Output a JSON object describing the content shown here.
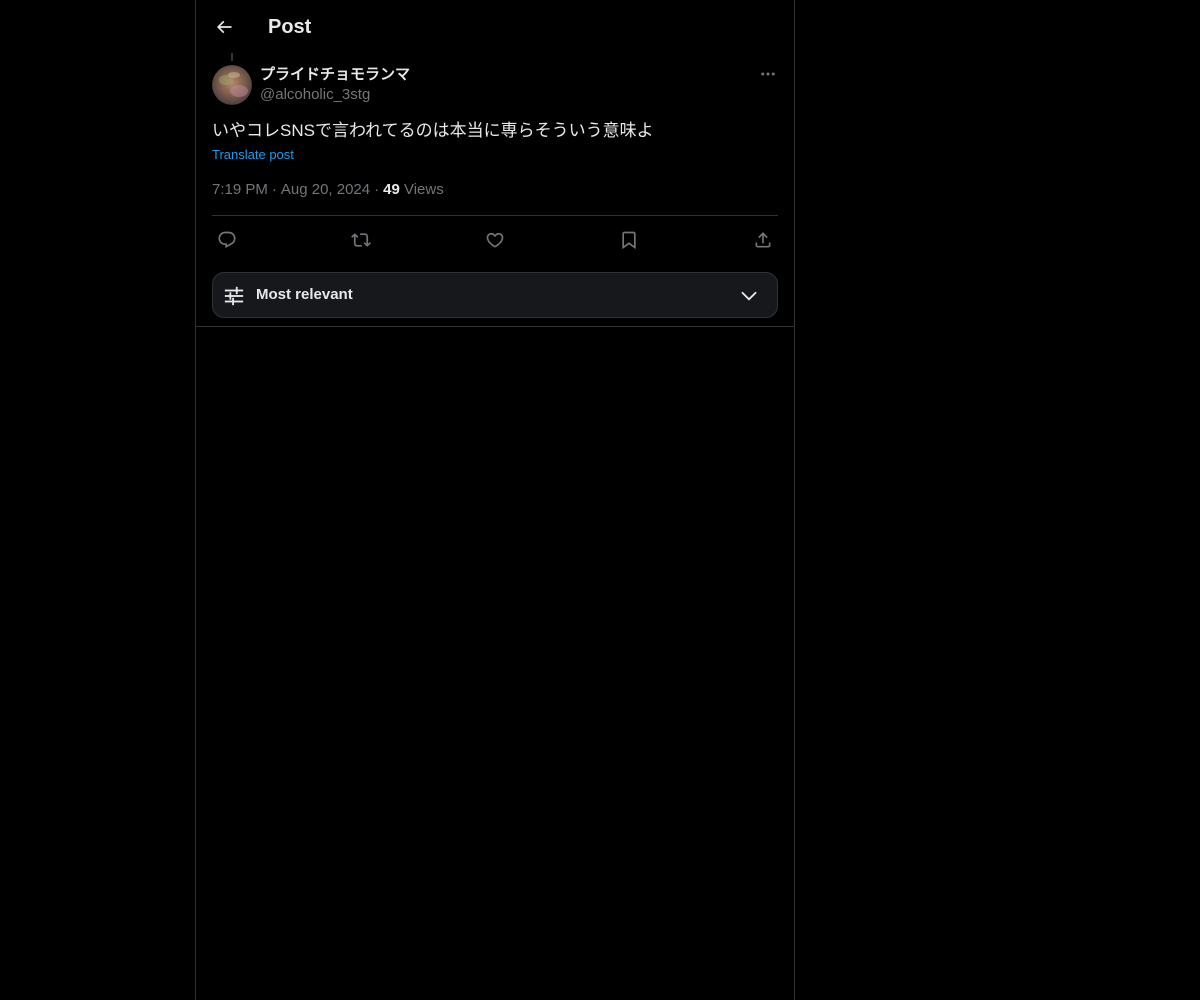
{
  "header": {
    "title": "Post",
    "back_icon": "arrow-left-icon"
  },
  "post": {
    "display_name": "プライドチョモランマ",
    "handle": "@alcoholic_3stg",
    "text": "いやコレSNSで言われてるのは本当に専らそういう意味よ",
    "translate_label": "Translate post",
    "time": "7:19 PM",
    "date": "Aug 20, 2024",
    "views_count": "49",
    "views_label": "Views",
    "separator": "·"
  },
  "actions": {
    "reply_icon": "reply-icon",
    "repost_icon": "repost-icon",
    "like_icon": "heart-icon",
    "bookmark_icon": "bookmark-icon",
    "share_icon": "share-icon"
  },
  "sort": {
    "label": "Most relevant",
    "icon": "sliders-icon",
    "chevron": "chevron-down-icon"
  },
  "colors": {
    "background": "#000000",
    "text_primary": "#e7e9ea",
    "text_secondary": "#71767b",
    "link": "#1d9bf0",
    "border": "#2f3336"
  }
}
